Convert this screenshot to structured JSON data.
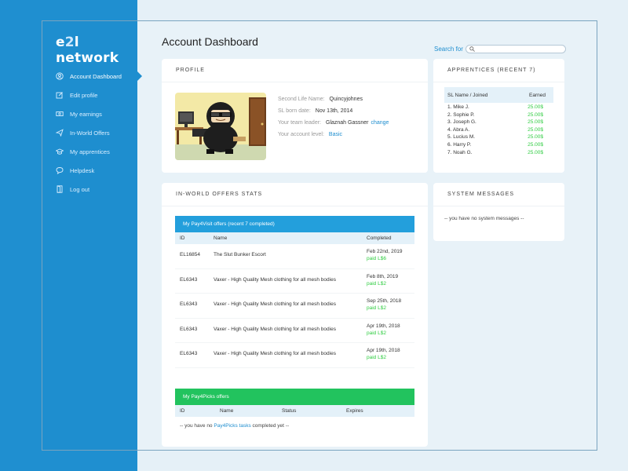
{
  "brand": {
    "logo_pre": "e",
    "logo_mid": "2",
    "logo_post": "l network"
  },
  "sidebar": {
    "items": [
      {
        "label": "Account Dashboard",
        "icon": "user-circle-icon"
      },
      {
        "label": "Edit profile",
        "icon": "edit-icon"
      },
      {
        "label": "My earnings",
        "icon": "money-icon"
      },
      {
        "label": "In-World Offers",
        "icon": "send-icon"
      },
      {
        "label": "My apprentices",
        "icon": "graduation-cap-icon"
      },
      {
        "label": "Helpdesk",
        "icon": "chat-icon"
      },
      {
        "label": "Log out",
        "icon": "door-icon"
      }
    ]
  },
  "header": {
    "title": "Account Dashboard"
  },
  "search": {
    "label": "Search for",
    "value": "",
    "placeholder": ""
  },
  "profile": {
    "title": "PROFILE",
    "fields": {
      "name_label": "Second Life Name:",
      "name_value": "Quincyjohnes",
      "born_label": "SL born date:",
      "born_value": "Nov 13th, 2014",
      "leader_label": "Your team leader:",
      "leader_value": "Glaznah Gassner",
      "leader_action": "change",
      "level_label": "Your account level:",
      "level_value": "Basic"
    }
  },
  "apprentices": {
    "title": "APPRENTICES (RECENT 7)",
    "col_name": "SL Name / Joined",
    "col_earned": "Earned",
    "rows": [
      {
        "name": "1. Mike J.",
        "earned": "25.00$"
      },
      {
        "name": "2. Sophie P.",
        "earned": "25.00$"
      },
      {
        "name": "3. Joseph G.",
        "earned": "25.00$"
      },
      {
        "name": "4. Abra A.",
        "earned": "25.00$"
      },
      {
        "name": "5. Lucius M.",
        "earned": "25.00$"
      },
      {
        "name": "6. Harry P.",
        "earned": "25.00$"
      },
      {
        "name": "7. Noah G.",
        "earned": "25.00$"
      }
    ]
  },
  "system": {
    "title": "SYSTEM MESSAGES",
    "message": "-- you have no system messages --"
  },
  "offers": {
    "title": "IN-WORLD OFFERS STATS",
    "visit": {
      "title": "My Pay4Visit offers (recent 7 completed)",
      "col_id": "ID",
      "col_name": "Name",
      "col_completed": "Completed",
      "rows": [
        {
          "id": "EL16854",
          "name": "The Slut Bunker Escort",
          "date": "Feb 22nd, 2019",
          "paid": "paid L$6"
        },
        {
          "id": "EL6343",
          "name": "Vaxer - High Quality Mesh clothing for all mesh bodies",
          "date": "Feb 8th, 2019",
          "paid": "paid L$2"
        },
        {
          "id": "EL6343",
          "name": "Vaxer - High Quality Mesh clothing for all mesh bodies",
          "date": "Sep 25th, 2018",
          "paid": "paid L$2"
        },
        {
          "id": "EL6343",
          "name": "Vaxer - High Quality Mesh clothing for all mesh bodies",
          "date": "Apr 19th, 2018",
          "paid": "paid L$2"
        },
        {
          "id": "EL6343",
          "name": "Vaxer - High Quality Mesh clothing for all mesh bodies",
          "date": "Apr 19th, 2018",
          "paid": "paid L$2"
        }
      ]
    },
    "picks": {
      "title": "My Pay4Picks offers",
      "col_id": "ID",
      "col_name": "Name",
      "col_status": "Status",
      "col_expires": "Expires",
      "note_pre": "-- you have no",
      "note_link": "Pay4Picks tasks",
      "note_post": "completed yet --"
    }
  },
  "colors": {
    "accent": "#1e8ecf",
    "visit_bar": "#239fdc",
    "picks_bar": "#22c35e",
    "earned": "#2ecc40"
  }
}
